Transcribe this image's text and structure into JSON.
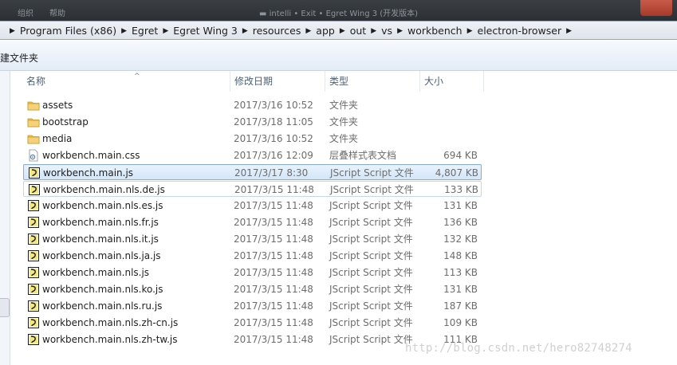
{
  "titlebar": {
    "ghost_left_1": "组织",
    "ghost_left_2": "帮助",
    "ghost_center": "▬ intelli • Exit • Egret Wing 3 (开发版本)"
  },
  "breadcrumb": [
    "Program Files (x86)",
    "Egret",
    "Egret Wing 3",
    "resources",
    "app",
    "out",
    "vs",
    "workbench",
    "electron-browser"
  ],
  "command_bar": {
    "new_folder": "建文件夹"
  },
  "columns": {
    "name": "名称",
    "modified": "修改日期",
    "type": "类型",
    "size": "大小"
  },
  "files": [
    {
      "name": "assets",
      "modified": "2017/3/16 10:52",
      "type": "文件夹",
      "size": "",
      "icon": "folder-icon"
    },
    {
      "name": "bootstrap",
      "modified": "2017/3/18 11:05",
      "type": "文件夹",
      "size": "",
      "icon": "folder-icon"
    },
    {
      "name": "media",
      "modified": "2017/3/16 10:52",
      "type": "文件夹",
      "size": "",
      "icon": "folder-icon"
    },
    {
      "name": "workbench.main.css",
      "modified": "2017/3/16 12:09",
      "type": "层叠样式表文档",
      "size": "694 KB",
      "icon": "css-file-icon"
    },
    {
      "name": "workbench.main.js",
      "modified": "2017/3/17 8:30",
      "type": "JScript Script 文件",
      "size": "4,807 KB",
      "icon": "jscript-file-icon",
      "state": "selected"
    },
    {
      "name": "workbench.main.nls.de.js",
      "modified": "2017/3/15 11:48",
      "type": "JScript Script 文件",
      "size": "133 KB",
      "icon": "jscript-file-icon",
      "state": "hover"
    },
    {
      "name": "workbench.main.nls.es.js",
      "modified": "2017/3/15 11:48",
      "type": "JScript Script 文件",
      "size": "131 KB",
      "icon": "jscript-file-icon"
    },
    {
      "name": "workbench.main.nls.fr.js",
      "modified": "2017/3/15 11:48",
      "type": "JScript Script 文件",
      "size": "136 KB",
      "icon": "jscript-file-icon"
    },
    {
      "name": "workbench.main.nls.it.js",
      "modified": "2017/3/15 11:48",
      "type": "JScript Script 文件",
      "size": "132 KB",
      "icon": "jscript-file-icon"
    },
    {
      "name": "workbench.main.nls.ja.js",
      "modified": "2017/3/15 11:48",
      "type": "JScript Script 文件",
      "size": "148 KB",
      "icon": "jscript-file-icon"
    },
    {
      "name": "workbench.main.nls.js",
      "modified": "2017/3/15 11:48",
      "type": "JScript Script 文件",
      "size": "113 KB",
      "icon": "jscript-file-icon"
    },
    {
      "name": "workbench.main.nls.ko.js",
      "modified": "2017/3/15 11:48",
      "type": "JScript Script 文件",
      "size": "131 KB",
      "icon": "jscript-file-icon"
    },
    {
      "name": "workbench.main.nls.ru.js",
      "modified": "2017/3/15 11:48",
      "type": "JScript Script 文件",
      "size": "187 KB",
      "icon": "jscript-file-icon"
    },
    {
      "name": "workbench.main.nls.zh-cn.js",
      "modified": "2017/3/15 11:48",
      "type": "JScript Script 文件",
      "size": "109 KB",
      "icon": "jscript-file-icon"
    },
    {
      "name": "workbench.main.nls.zh-tw.js",
      "modified": "2017/3/15 11:48",
      "type": "JScript Script 文件",
      "size": "111 KB",
      "icon": "jscript-file-icon"
    }
  ],
  "watermark": "http://blog.csdn.net/hero82748274",
  "colors": {
    "folder": "#f0c24b",
    "selection_border": "#84acdd",
    "header_text": "#4c607a"
  }
}
